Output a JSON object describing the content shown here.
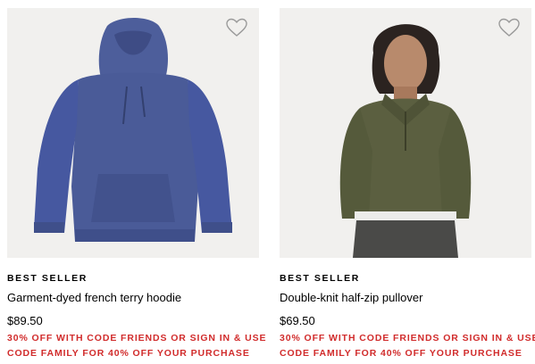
{
  "products": [
    {
      "badge": "BEST SELLER",
      "name": "Garment-dyed french terry hoodie",
      "price": "$89.50",
      "promo_line1": "30% OFF WITH CODE FRIENDS OR SIGN IN & USE",
      "promo_line2": "CODE FAMILY FOR 40% OFF YOUR PURCHASE",
      "color": "#4a5b98"
    },
    {
      "badge": "BEST SELLER",
      "name": "Double-knit half-zip pullover",
      "price": "$69.50",
      "promo_line1": "30% OFF WITH CODE FRIENDS OR SIGN IN & USE",
      "promo_line2": "CODE FAMILY FOR 40% OFF YOUR PURCHASE",
      "color": "#5b5f40"
    }
  ],
  "icons": {
    "favorite": "heart-outline-icon"
  },
  "accent_colors": {
    "promo": "#d12c2c",
    "image_bg": "#f1f0ee"
  }
}
